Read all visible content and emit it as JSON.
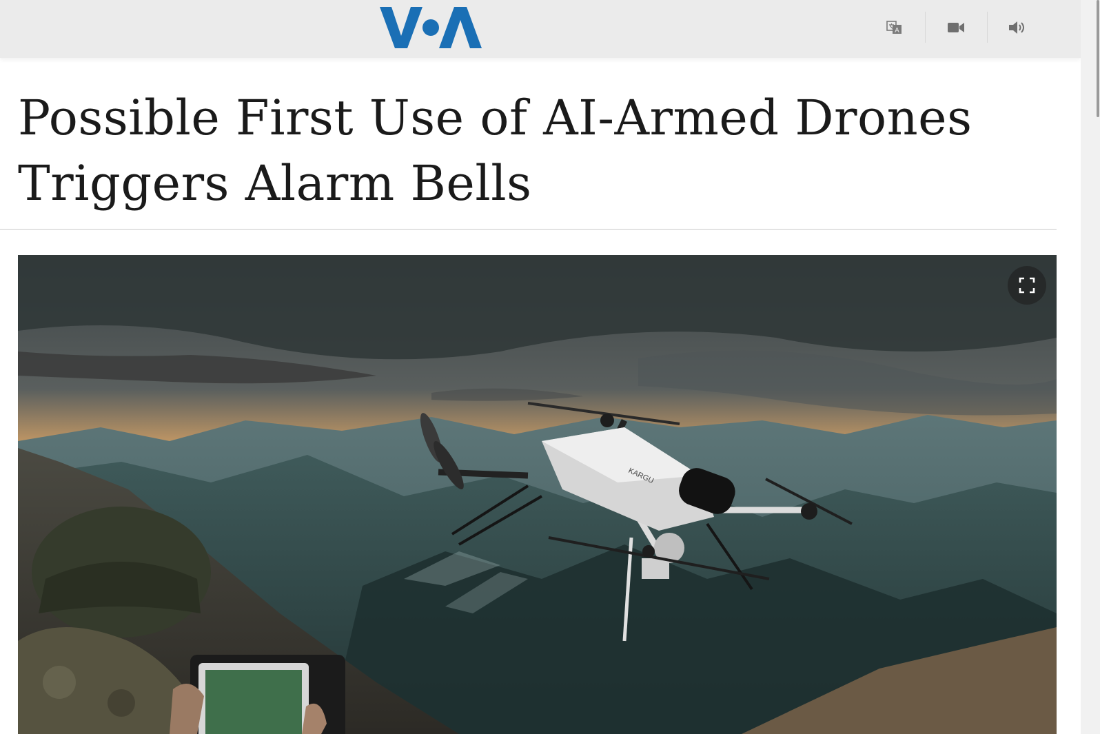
{
  "header": {
    "logo_text": "VOA",
    "brand_color": "#1a6fb5",
    "icons": [
      "translate-icon",
      "video-camera-icon",
      "speaker-icon"
    ]
  },
  "article": {
    "headline": "Possible First Use of AI-Armed Drones Triggers Alarm Bells"
  },
  "hero_image": {
    "expand_icon": "fullscreen-icon",
    "drone_label": "KARGU"
  }
}
